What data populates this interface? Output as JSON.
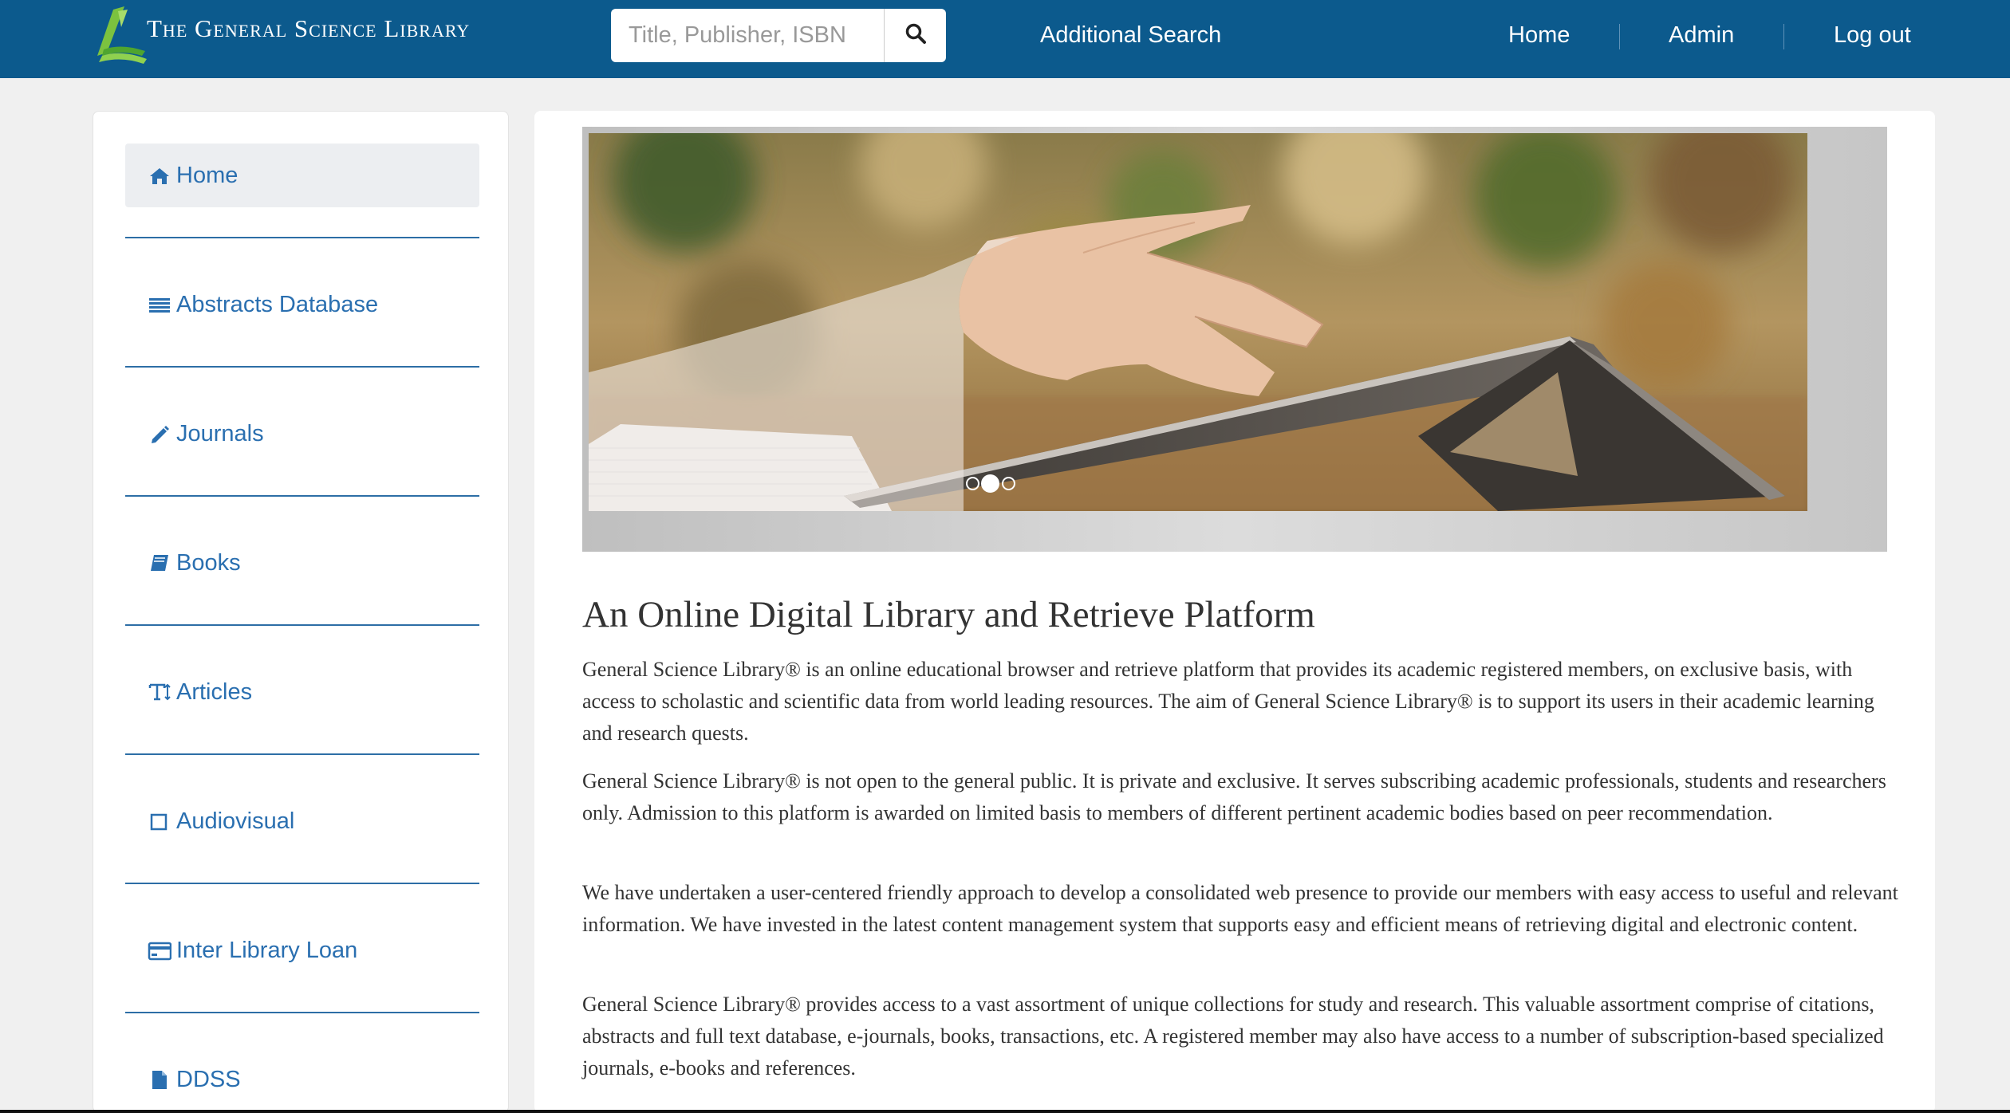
{
  "header": {
    "logo_text": "The General Science Library",
    "search_placeholder": "Title, Publisher, ISBN",
    "additional_search": "Additional Search",
    "nav": [
      "Home",
      "Admin",
      "Log out"
    ]
  },
  "sidebar": {
    "items": [
      {
        "label": "Home",
        "icon": "home-icon",
        "active": true
      },
      {
        "label": "Abstracts Database",
        "icon": "list-icon"
      },
      {
        "label": "Journals",
        "icon": "pencil-icon"
      },
      {
        "label": "Books",
        "icon": "book-icon"
      },
      {
        "label": "Articles",
        "icon": "text-height-icon"
      },
      {
        "label": "Audiovisual",
        "icon": "square-icon"
      },
      {
        "label": "Inter Library Loan",
        "icon": "credit-card-icon"
      },
      {
        "label": "DDSS",
        "icon": "file-icon"
      }
    ]
  },
  "carousel": {
    "active_index": 1,
    "slide_count": 3
  },
  "main": {
    "headline": "An Online Digital Library and Retrieve Platform",
    "paragraphs": [
      "General Science Library® is an online educational browser and retrieve platform that provides its academic registered members, on exclusive basis, with access to scholastic and scientific data from world leading resources. The aim of General Science Library® is to support its users in their academic learning and research quests.",
      "General Science Library® is not open to the general public. It is private and exclusive. It serves subscribing academic professionals, students and researchers only. Admission to this platform is awarded on limited basis to members of different pertinent academic bodies based on peer recommendation.",
      "We have undertaken a user-centered friendly approach to develop a consolidated web presence to provide our members with easy access to useful and relevant information. We have invested in the latest content management system that supports easy and efficient means of retrieving digital and electronic content.",
      "General Science Library® provides access to a vast assortment of unique collections for study and research. This valuable assortment comprise of citations, abstracts and full text database, e-journals, books, transactions, etc. A registered member may also have access to a number of subscription-based specialized journals, e-books and references."
    ]
  },
  "colors": {
    "header_bg": "#0c5a8d",
    "link": "#2a6fb0",
    "logo_green": "#7cc23f"
  }
}
